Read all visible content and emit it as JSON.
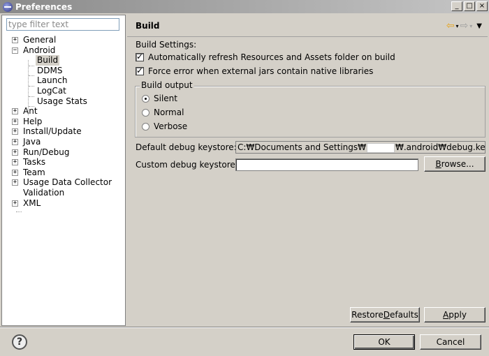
{
  "window": {
    "title": "Preferences",
    "controls": {
      "minimize": "_",
      "maximize": "□",
      "close": "×"
    }
  },
  "filter": {
    "placeholder": "type filter text",
    "value": ""
  },
  "tree": {
    "general": "General",
    "android": "Android",
    "android_children": [
      "Build",
      "DDMS",
      "Launch",
      "LogCat",
      "Usage Stats"
    ],
    "ant": "Ant",
    "help": "Help",
    "install_update": "Install/Update",
    "java": "Java",
    "run_debug": "Run/Debug",
    "tasks": "Tasks",
    "team": "Team",
    "usage_data_collector": "Usage Data Collector",
    "validation": "Validation",
    "xml": "XML",
    "selected": "Build"
  },
  "page": {
    "title": "Build",
    "nav": {
      "back": "⇦",
      "forward": "⇨",
      "dropdown": "▾",
      "menu": "▼"
    },
    "build_settings_label": "Build Settings:",
    "checkbox_refresh": "Automatically refresh Resources and Assets folder on build",
    "checkbox_force_error": "Force error when external jars contain native libraries",
    "build_output": {
      "legend": "Build output",
      "options": [
        "Silent",
        "Normal",
        "Verbose"
      ],
      "selected": "Silent"
    },
    "default_keystore_label": "Default debug keystore:",
    "default_keystore_prefix": "C:₩Documents and Settings₩",
    "default_keystore_suffix": "₩.android₩debug.keystore",
    "custom_keystore_label": "Custom debug keystore:",
    "custom_keystore_value": "",
    "browse_rest": "rowse...",
    "browse_mnemonic": "B"
  },
  "buttons": {
    "restore_mnemonic": "D",
    "restore_pre": "Restore ",
    "restore_post": "efaults",
    "apply_mnemonic": "A",
    "apply_post": "pply",
    "ok": "OK",
    "cancel": "Cancel"
  },
  "help_icon": "?"
}
